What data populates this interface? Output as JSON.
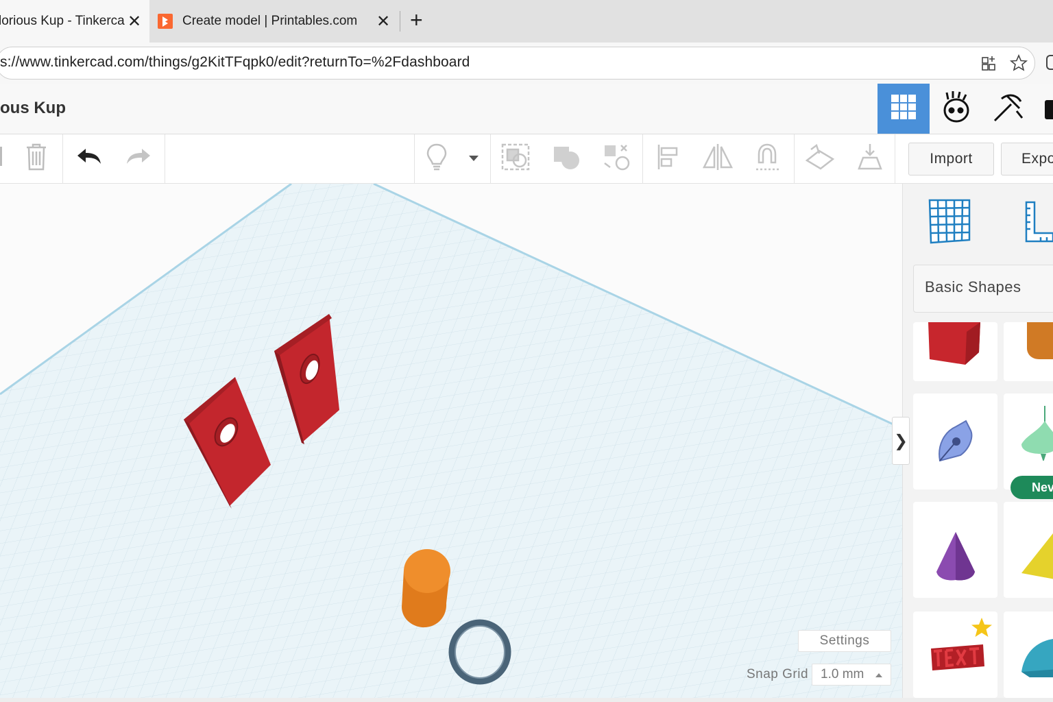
{
  "browser": {
    "tabs": [
      {
        "title": "lorious Kup - Tinkerca",
        "active": true
      },
      {
        "title": "Create model | Printables.com",
        "active": false
      }
    ],
    "close_glyph": "✕",
    "new_tab_glyph": "+",
    "url": "s://www.tinkercad.com/things/g2KitTFqpk0/edit?returnTo=%2Fdashboard"
  },
  "app": {
    "design_title": "ous Kup",
    "accent_color": "#4a90d9",
    "toolbar": {
      "import_label": "Import",
      "export_label": "Expo"
    },
    "panel": {
      "category_label": "Basic Shapes",
      "new_badge": "Nev",
      "collapse_glyph": "❯"
    },
    "workplane": {
      "settings_label": "Settings",
      "snap_grid_label": "Snap Grid",
      "snap_grid_value": "1.0 mm"
    }
  }
}
